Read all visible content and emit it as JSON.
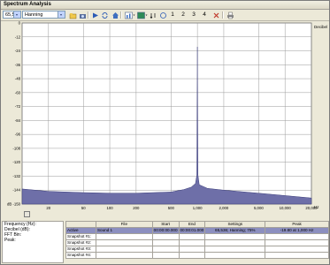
{
  "window": {
    "title": "Spectrum Analysis"
  },
  "toolbar": {
    "fft_size": "65,536",
    "window_function": "Hanning",
    "overlay_numbers": [
      "1",
      "2",
      "3",
      "4"
    ]
  },
  "chart_data": {
    "type": "line",
    "title": "",
    "x_scale": "log",
    "y_unit_label": "Decibel",
    "x_unit_label": "Hz",
    "xlim": [
      10,
      20000
    ],
    "ylim": [
      -150,
      0
    ],
    "x_tick_labels": [
      "10",
      "20",
      "50",
      "100",
      "200",
      "500",
      "1,000",
      "2,000",
      "5,000",
      "10,000",
      "20,000"
    ],
    "y_tick_labels": [
      "0",
      "-12",
      "-24",
      "-36",
      "-48",
      "-60",
      "-72",
      "-84",
      "-96",
      "-108",
      "-120",
      "-132",
      "-144",
      "dB -150"
    ],
    "grid": true,
    "fill_color": "#6e6fa8",
    "points": [
      [
        10,
        -137.5
      ],
      [
        20,
        -139.5
      ],
      [
        50,
        -140.5
      ],
      [
        100,
        -141
      ],
      [
        200,
        -141
      ],
      [
        500,
        -140
      ],
      [
        700,
        -138
      ],
      [
        850,
        -136
      ],
      [
        950,
        -133
      ],
      [
        985,
        -126
      ],
      [
        995,
        -60
      ],
      [
        1000,
        -19.8
      ],
      [
        1005,
        -60
      ],
      [
        1015,
        -126
      ],
      [
        1050,
        -134
      ],
      [
        1300,
        -137
      ],
      [
        2000,
        -138.5
      ],
      [
        5000,
        -141
      ],
      [
        10000,
        -143
      ],
      [
        20000,
        -145
      ]
    ]
  },
  "info_panel": {
    "frequency": "Frequency (Hz):",
    "decibel": "Decibel (dB):",
    "fft_bin": "FFT Bin:",
    "peak": "Peak:"
  },
  "snapshots": {
    "headers": [
      "",
      "File",
      "Start",
      "End",
      "Settings",
      "Peak"
    ],
    "rows": [
      [
        "Active",
        "Sound 1",
        "00:00:00.000",
        "00:00:01.000",
        "65,536; Hanning; 75%",
        "-19.80 at 1,000 Hz"
      ],
      [
        "Snapshot #1:",
        "",
        "",
        "",
        "",
        ""
      ],
      [
        "Snapshot #2:",
        "",
        "",
        "",
        "",
        ""
      ],
      [
        "Snapshot #3:",
        "",
        "",
        "",
        "",
        ""
      ],
      [
        "Snapshot #4:",
        "",
        "",
        "",
        "",
        ""
      ]
    ]
  },
  "colors": {
    "accent": "#6e6fa8",
    "active_row": "#8c8fbf",
    "chrome": "#ece9d8"
  }
}
